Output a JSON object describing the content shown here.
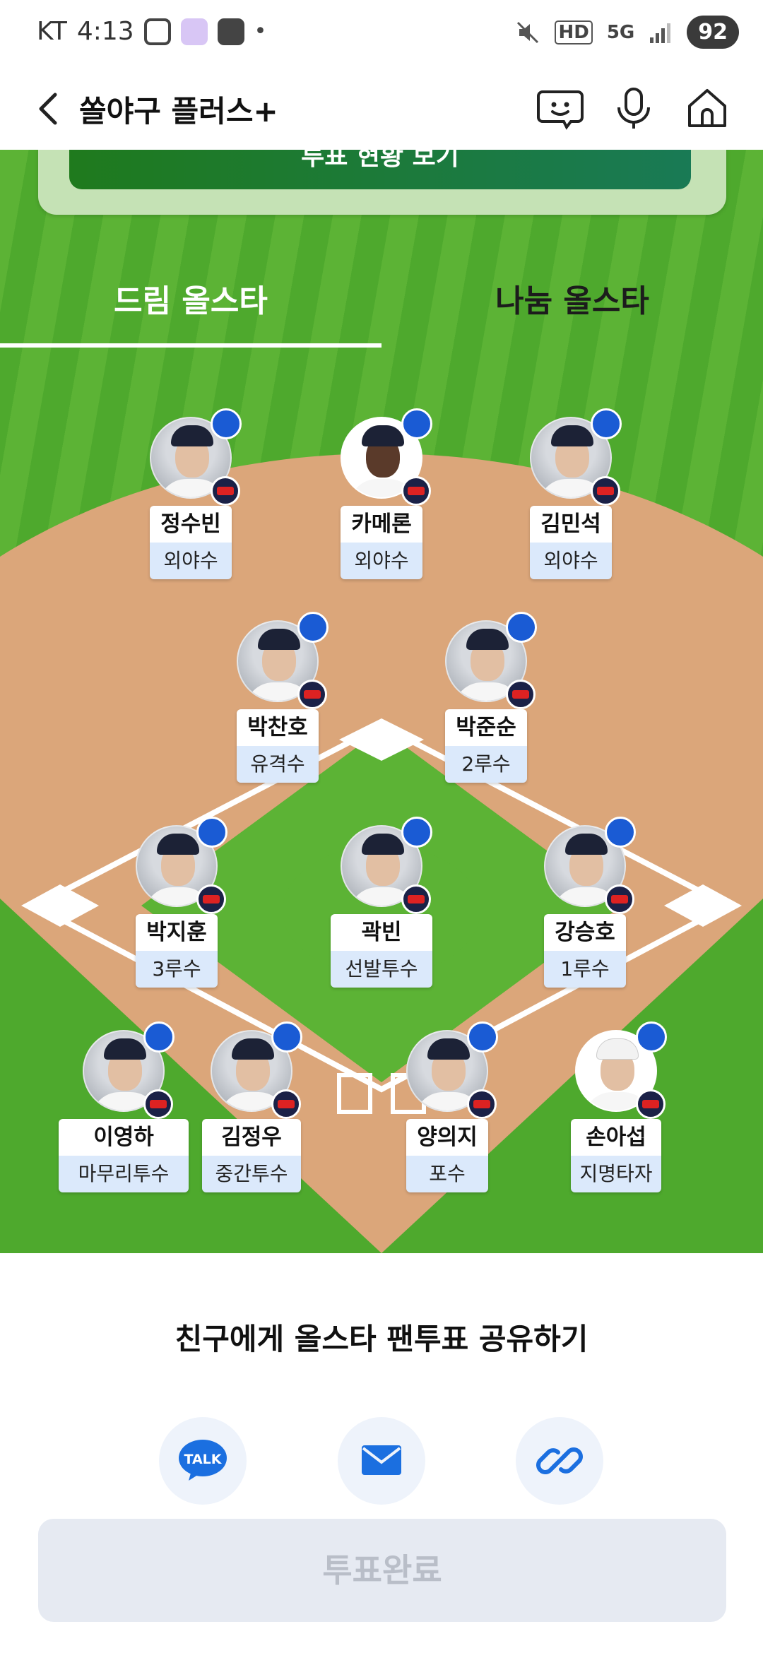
{
  "status_bar": {
    "carrier": "KT",
    "time": "4:13",
    "dot": "•",
    "battery": "92",
    "hd": "HD",
    "network": "5G"
  },
  "header": {
    "title": "쏠야구 플러스+"
  },
  "banner": {
    "button_label": "투표 현황 보기"
  },
  "tabs": [
    {
      "label": "드림 올스타",
      "active": true
    },
    {
      "label": "나눔 올스타",
      "active": false
    }
  ],
  "players": [
    {
      "name": "정수빈",
      "position": "외야수"
    },
    {
      "name": "카메론",
      "position": "외야수"
    },
    {
      "name": "김민석",
      "position": "외야수"
    },
    {
      "name": "박찬호",
      "position": "유격수"
    },
    {
      "name": "박준순",
      "position": "2루수"
    },
    {
      "name": "박지훈",
      "position": "3루수"
    },
    {
      "name": "곽빈",
      "position": "선발투수"
    },
    {
      "name": "강승호",
      "position": "1루수"
    },
    {
      "name": "이영하",
      "position": "마무리투수"
    },
    {
      "name": "김정우",
      "position": "중간투수"
    },
    {
      "name": "양의지",
      "position": "포수"
    },
    {
      "name": "손아섭",
      "position": "지명타자"
    }
  ],
  "share": {
    "title": "친구에게 올스타 팬투표 공유하기",
    "buttons": [
      {
        "icon": "kakaotalk-icon",
        "label": "TALK"
      },
      {
        "icon": "mail-icon"
      },
      {
        "icon": "link-icon"
      }
    ]
  },
  "vote_button": {
    "label": "투표완료"
  },
  "colors": {
    "field_green": "#4ea92d",
    "infield_dirt": "#dba67a",
    "swap_badge": "#1a5bd4",
    "position_bg": "#dbe9fb"
  }
}
